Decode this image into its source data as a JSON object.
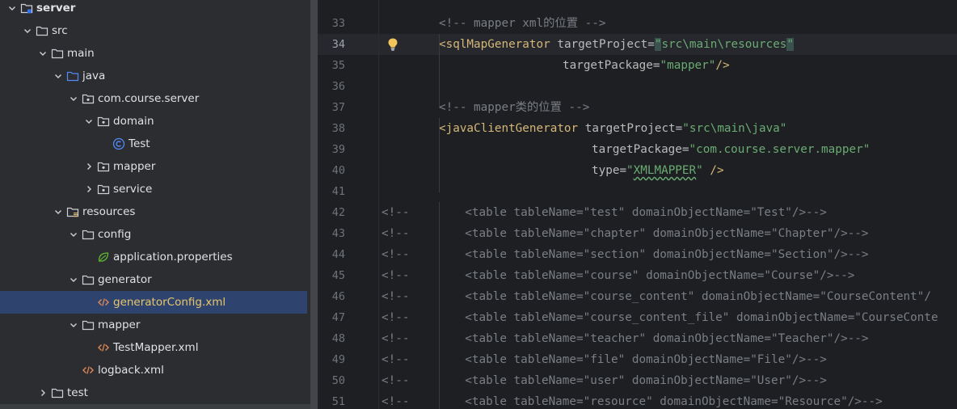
{
  "project_tree": {
    "items": [
      {
        "label": "server",
        "depth": 0,
        "expanded": true,
        "icon": "module-folder-icon",
        "bold": true
      },
      {
        "label": "src",
        "depth": 1,
        "expanded": true,
        "icon": "folder-icon"
      },
      {
        "label": "main",
        "depth": 2,
        "expanded": true,
        "icon": "folder-icon"
      },
      {
        "label": "java",
        "depth": 3,
        "expanded": true,
        "icon": "source-root-icon"
      },
      {
        "label": "com.course.server",
        "depth": 4,
        "expanded": true,
        "icon": "package-icon"
      },
      {
        "label": "domain",
        "depth": 5,
        "expanded": true,
        "icon": "package-icon"
      },
      {
        "label": "Test",
        "depth": 6,
        "icon": "java-class-icon"
      },
      {
        "label": "mapper",
        "depth": 5,
        "expanded": false,
        "icon": "package-icon"
      },
      {
        "label": "service",
        "depth": 5,
        "expanded": false,
        "icon": "package-icon"
      },
      {
        "label": "resources",
        "depth": 3,
        "expanded": true,
        "icon": "resources-root-icon"
      },
      {
        "label": "config",
        "depth": 4,
        "expanded": true,
        "icon": "folder-icon"
      },
      {
        "label": "application.properties",
        "depth": 5,
        "icon": "spring-properties-icon"
      },
      {
        "label": "generator",
        "depth": 4,
        "expanded": true,
        "icon": "folder-icon"
      },
      {
        "label": "generatorConfig.xml",
        "depth": 5,
        "icon": "xml-file-icon",
        "selected": true
      },
      {
        "label": "mapper",
        "depth": 4,
        "expanded": true,
        "icon": "folder-icon"
      },
      {
        "label": "TestMapper.xml",
        "depth": 5,
        "icon": "xml-file-icon"
      },
      {
        "label": "logback.xml",
        "depth": 4,
        "icon": "xml-file-icon"
      },
      {
        "label": "test",
        "depth": 2,
        "expanded": false,
        "icon": "folder-icon"
      }
    ]
  },
  "editor": {
    "current_line": 34,
    "lines": [
      {
        "num": "33",
        "tokens": [
          {
            "t": "<!-- mapper xml的位置 -->",
            "c": "comment"
          }
        ]
      },
      {
        "num": "34",
        "tokens": [
          {
            "t": "<sqlMapGenerator",
            "c": "tag"
          },
          {
            "t": " targetProject",
            "c": "attr"
          },
          {
            "t": "=",
            "c": "plain"
          },
          {
            "t": "\"",
            "c": "str",
            "q": true
          },
          {
            "t": "src\\main\\resources",
            "c": "str"
          },
          {
            "t": "\"",
            "c": "str",
            "q": true
          }
        ]
      },
      {
        "num": "35",
        "tokens": [
          {
            "t": "targetPackage",
            "c": "attr"
          },
          {
            "t": "=",
            "c": "plain"
          },
          {
            "t": "\"mapper\"",
            "c": "str"
          },
          {
            "t": "/>",
            "c": "tag"
          }
        ]
      },
      {
        "num": "36",
        "tokens": []
      },
      {
        "num": "37",
        "tokens": [
          {
            "t": "<!-- mapper类的位置 -->",
            "c": "comment"
          }
        ]
      },
      {
        "num": "38",
        "tokens": [
          {
            "t": "<javaClientGenerator",
            "c": "tag"
          },
          {
            "t": " targetProject",
            "c": "attr"
          },
          {
            "t": "=",
            "c": "plain"
          },
          {
            "t": "\"src\\main\\java\"",
            "c": "str"
          }
        ]
      },
      {
        "num": "39",
        "tokens": [
          {
            "t": "targetPackage",
            "c": "attr"
          },
          {
            "t": "=",
            "c": "plain"
          },
          {
            "t": "\"com.course.server.mapper\"",
            "c": "str"
          }
        ]
      },
      {
        "num": "40",
        "tokens": [
          {
            "t": "type",
            "c": "attr"
          },
          {
            "t": "=",
            "c": "plain"
          },
          {
            "t": "\"",
            "c": "str"
          },
          {
            "t": "XMLMAPPER",
            "c": "str",
            "w": true
          },
          {
            "t": "\"",
            "c": "str"
          },
          {
            "t": " />",
            "c": "tag"
          }
        ]
      },
      {
        "num": "41",
        "tokens": []
      },
      {
        "num": "42",
        "tokens": [
          {
            "t": "<!--        <table tableName=\"test\" domainObjectName=\"Test\"/>-->",
            "c": "comment"
          }
        ]
      },
      {
        "num": "43",
        "tokens": [
          {
            "t": "<!--        <table tableName=\"chapter\" domainObjectName=\"Chapter\"/>-->",
            "c": "comment"
          }
        ]
      },
      {
        "num": "44",
        "tokens": [
          {
            "t": "<!--        <table tableName=\"section\" domainObjectName=\"Section\"/>-->",
            "c": "comment"
          }
        ]
      },
      {
        "num": "45",
        "tokens": [
          {
            "t": "<!--        <table tableName=\"course\" domainObjectName=\"Course\"/>-->",
            "c": "comment"
          }
        ]
      },
      {
        "num": "46",
        "tokens": [
          {
            "t": "<!--        <table tableName=\"course_content\" domainObjectName=\"CourseContent\"/",
            "c": "comment"
          }
        ]
      },
      {
        "num": "47",
        "tokens": [
          {
            "t": "<!--        <table tableName=\"course_content_file\" domainObjectName=\"CourseConte",
            "c": "comment"
          }
        ]
      },
      {
        "num": "48",
        "tokens": [
          {
            "t": "<!--        <table tableName=\"teacher\" domainObjectName=\"Teacher\"/>-->",
            "c": "comment"
          }
        ]
      },
      {
        "num": "49",
        "tokens": [
          {
            "t": "<!--        <table tableName=\"file\" domainObjectName=\"File\"/>-->",
            "c": "comment"
          }
        ]
      },
      {
        "num": "50",
        "tokens": [
          {
            "t": "<!--        <table tableName=\"user\" domainObjectName=\"User\"/>-->",
            "c": "comment"
          }
        ]
      },
      {
        "num": "51",
        "tokens": [
          {
            "t": "<!--        <table tableName=\"resource\" domainObjectName=\"Resource\"/>-->",
            "c": "comment"
          }
        ]
      }
    ]
  },
  "colors": {
    "tree_bg": "#2b2d30",
    "editor_bg": "#1e1f22",
    "selection": "#2e436e",
    "tag": "#d5b778",
    "string": "#6aab73",
    "comment": "#7a7e85"
  }
}
